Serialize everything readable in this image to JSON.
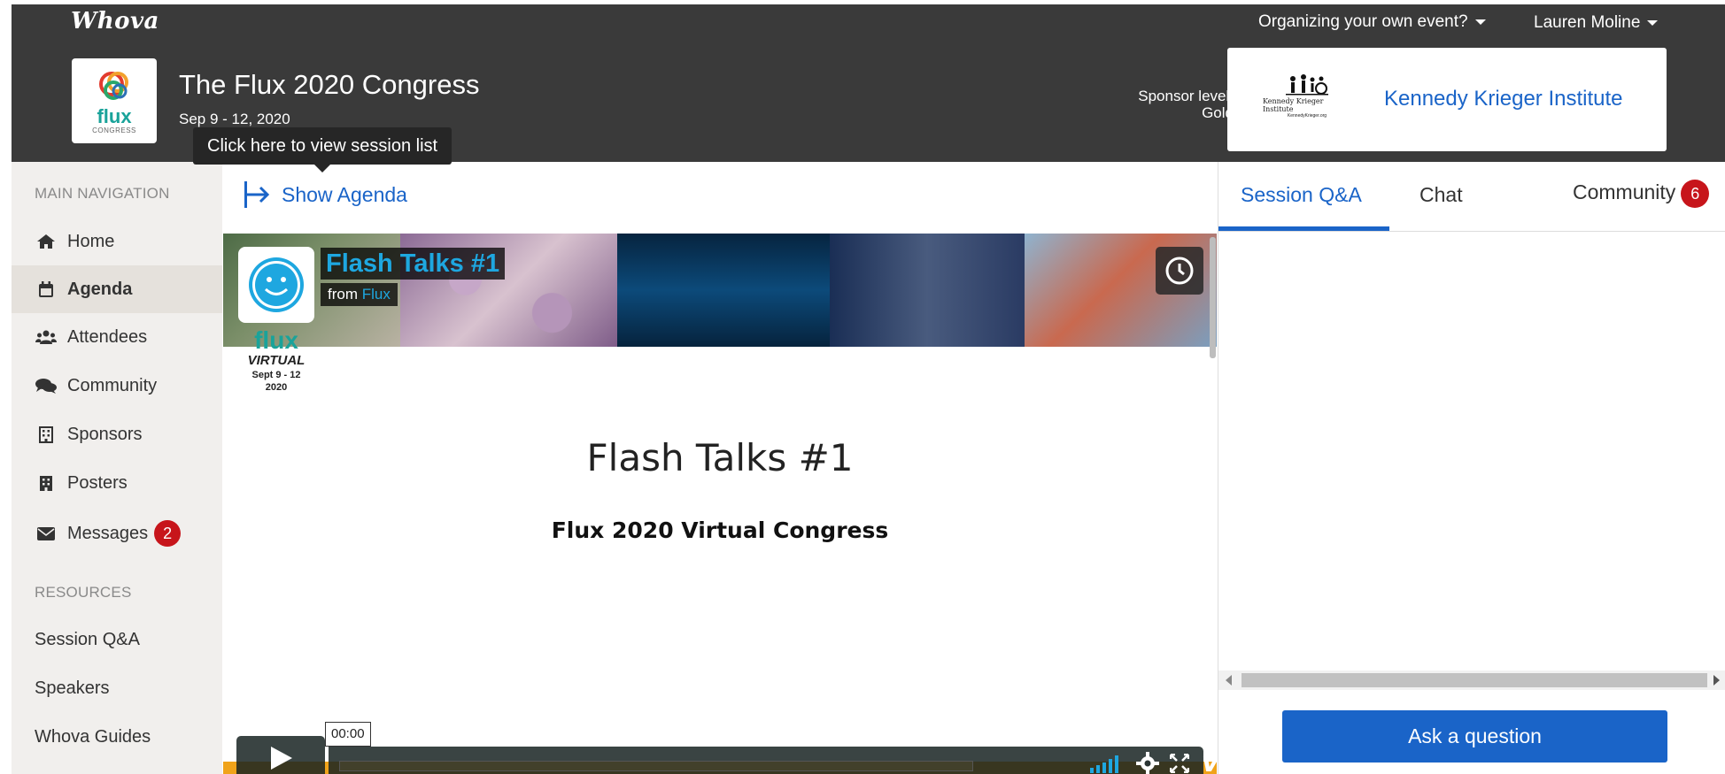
{
  "topbar": {
    "brand": "Whova",
    "organize_menu": "Organizing your own event?",
    "user_menu": "Lauren Moline"
  },
  "event": {
    "logo_word": "flux",
    "logo_sub": "CONGRESS",
    "title": "The Flux 2020 Congress",
    "dates": "Sep 9 - 12, 2020"
  },
  "sponsor": {
    "level_label": "Sponsor level:",
    "level_value": "Gold",
    "logo_text": "Kennedy Krieger Institute",
    "logo_url_text": "KennedyKrieger.org",
    "name": "Kennedy Krieger Institute"
  },
  "tooltip": "Click here to view session list",
  "sidebar": {
    "main_nav_heading": "MAIN NAVIGATION",
    "items": [
      {
        "label": "Home",
        "icon": "home-icon"
      },
      {
        "label": "Agenda",
        "icon": "calendar-icon",
        "active": true
      },
      {
        "label": "Attendees",
        "icon": "users-icon"
      },
      {
        "label": "Community",
        "icon": "comments-icon"
      },
      {
        "label": "Sponsors",
        "icon": "building-icon"
      },
      {
        "label": "Posters",
        "icon": "building-solid-icon"
      },
      {
        "label": "Messages",
        "icon": "envelope-icon",
        "badge": "2"
      }
    ],
    "resources_heading": "RESOURCES",
    "resources": [
      "Session Q&A",
      "Speakers",
      "Whova Guides"
    ]
  },
  "main": {
    "show_agenda": "Show Agenda",
    "video": {
      "title": "Flash Talks #1",
      "from_label": "from",
      "from_channel": "Flux",
      "logo_word": "flux",
      "logo_virtual": "VIRTUAL",
      "logo_dates": "Sept 9 - 12",
      "logo_year": "2020",
      "slide_title": "Flash Talks #1",
      "slide_subtitle": "Flux 2020 Virtual Congress",
      "time": "00:00",
      "brand": "vimeo"
    }
  },
  "right_panel": {
    "tabs": [
      {
        "label": "Session Q&A",
        "active": true
      },
      {
        "label": "Chat"
      },
      {
        "label": "Community",
        "badge": "6"
      }
    ],
    "ask_button": "Ask a question"
  },
  "colors": {
    "header_bg": "#3a3a3a",
    "accent_blue": "#1a64c8",
    "badge_red": "#c7151b",
    "sidebar_bg": "#f1efed",
    "flux_teal": "#1aa39a"
  }
}
